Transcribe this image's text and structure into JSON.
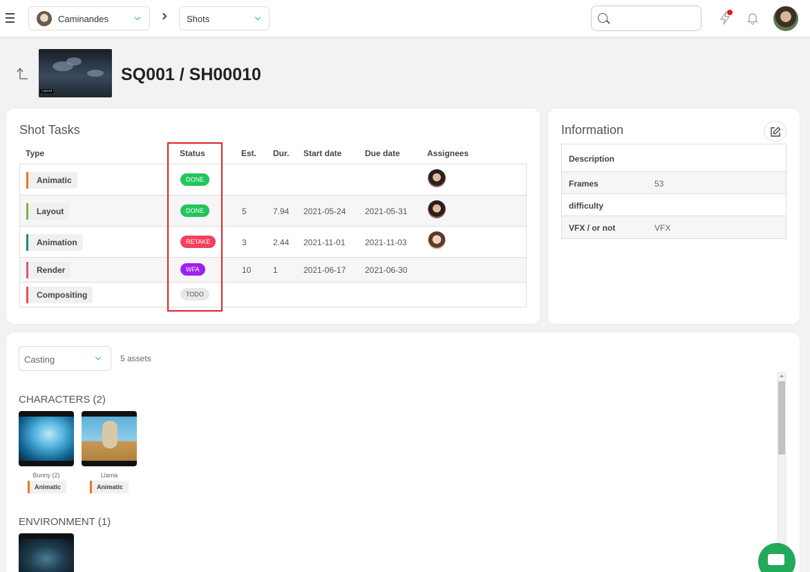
{
  "topbar": {
    "production": "Caminandes",
    "section": "Shots",
    "search": {
      "value": "",
      "placeholder": ""
    }
  },
  "header": {
    "title": "SQ001 / SH00010",
    "thumb_tag": "Layout"
  },
  "tasks": {
    "title": "Shot Tasks",
    "columns": [
      "Type",
      "Status",
      "Est.",
      "Dur.",
      "Start date",
      "Due date",
      "Assignees"
    ],
    "rows": [
      {
        "type": "Animatic",
        "type_color": "#e8781a",
        "status": "DONE",
        "status_color": "#22c55e",
        "est": "",
        "dur": "",
        "start": "",
        "due": "",
        "assignee": "woman-avatar"
      },
      {
        "type": "Layout",
        "type_color": "#7cb342",
        "status": "DONE",
        "status_color": "#22c55e",
        "est": "5",
        "dur": "7.94",
        "start": "2021-05-24",
        "due": "2021-05-31",
        "assignee": "woman-avatar"
      },
      {
        "type": "Animation",
        "type_color": "#1a8a7a",
        "status": "RETAKE",
        "status_color": "#f43f5e",
        "est": "3",
        "dur": "2.44",
        "start": "2021-11-01",
        "due": "2021-11-03",
        "assignee": "woman-avatar-2"
      },
      {
        "type": "Render",
        "type_color": "#e05080",
        "status": "WFA",
        "status_color": "#a020f0",
        "est": "10",
        "dur": "1",
        "start": "2021-06-17",
        "due": "2021-06-30",
        "assignee": ""
      },
      {
        "type": "Compositing",
        "type_color": "#f04a4a",
        "status": "TODO",
        "status_color": "#e8e8e8",
        "est": "",
        "dur": "",
        "start": "",
        "due": "",
        "assignee": ""
      }
    ]
  },
  "info": {
    "title": "Information",
    "rows": [
      {
        "key": "Description",
        "value": ""
      },
      {
        "key": "Frames",
        "value": "53"
      },
      {
        "key": "difficulty",
        "value": ""
      },
      {
        "key": "VFX / or not",
        "value": "VFX"
      }
    ]
  },
  "casting": {
    "dropdown": "Casting",
    "count": "5 assets",
    "sections": [
      {
        "title": "CHARACTERS (2)",
        "assets": [
          {
            "name": "Bunny (2)",
            "task": "Animatic"
          },
          {
            "name": "Llama",
            "task": "Animatic"
          }
        ]
      },
      {
        "title": "ENVIRONMENT (1)",
        "assets": []
      }
    ]
  },
  "colors": {
    "accent": "#22a95a",
    "highlight": "#dd2222"
  }
}
